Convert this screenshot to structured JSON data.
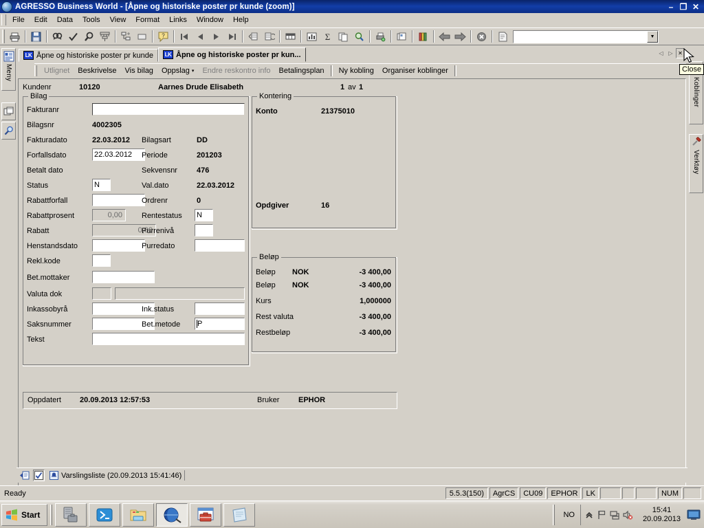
{
  "window": {
    "title": "AGRESSO Business World - [Åpne og historiske poster pr kunde (zoom)]",
    "app_icon": "globe-icon",
    "minimize": "–",
    "restore": "❐",
    "close": "✕"
  },
  "menubar": {
    "items": [
      {
        "label": "File"
      },
      {
        "label": "Edit"
      },
      {
        "label": "Data"
      },
      {
        "label": "Tools"
      },
      {
        "label": "View"
      },
      {
        "label": "Format"
      },
      {
        "label": "Links"
      },
      {
        "label": "Window"
      },
      {
        "label": "Help"
      }
    ]
  },
  "toolbar": {
    "buttons": [
      "print-icon",
      "save-icon",
      "find-icon",
      "check-icon",
      "zoom-icon",
      "filter-icon",
      "hierarchy-icon",
      "window-icon",
      "help-icon",
      "first-record-icon",
      "previous-record-icon",
      "next-record-icon",
      "last-record-icon",
      "insert-row-icon",
      "delete-row-icon",
      "table-icon",
      "chart-icon",
      "sum-icon",
      "copy-icon",
      "query-icon",
      "print-preview-icon",
      "cards-icon",
      "books-icon",
      "back-icon",
      "forward-icon",
      "cancel-icon",
      "document-icon"
    ],
    "combo_value": "",
    "combo_arrow": "▼"
  },
  "left_rail": {
    "tab_label": "Meny",
    "tab_icon": "menu-list-icon",
    "icons": [
      "copy-windows-icon",
      "search-magnifier-icon"
    ]
  },
  "right_rail": {
    "tabs": [
      {
        "label": "Koblinger",
        "icon": "links-chain-icon"
      },
      {
        "label": "Verktøy",
        "icon": "hammer-icon"
      }
    ]
  },
  "doc_tabs": {
    "tabs": [
      {
        "badge": "LK",
        "label": "Åpne og historiske poster pr kunde",
        "active": false
      },
      {
        "badge": "LK",
        "label": "Åpne og historiske poster pr kun...",
        "active": true
      }
    ],
    "nav": {
      "prev": "◁",
      "next": "▷",
      "close": "✕"
    }
  },
  "tooltip": {
    "text": "Close"
  },
  "function_band": {
    "left_items": [
      {
        "label": "Utlignet",
        "disabled": true
      },
      {
        "label": "Beskrivelse",
        "disabled": false
      },
      {
        "label": "Vis bilag",
        "disabled": false
      },
      {
        "label": "Oppslag",
        "disabled": false,
        "has_caret": true
      },
      {
        "label": "Endre reskontro info",
        "disabled": true
      },
      {
        "label": "Betalingsplan",
        "disabled": false
      }
    ],
    "right_items": [
      {
        "label": "Ny kobling",
        "disabled": false
      },
      {
        "label": "Organiser koblinger",
        "disabled": false
      }
    ],
    "caret": "▾"
  },
  "form": {
    "header": {
      "kundenr_label": "Kundenr",
      "kundenr_value": "10120",
      "customer_name": "Aarnes Drude Elisabeth",
      "record_position": "1",
      "record_of": "av",
      "record_total": "1"
    },
    "bilag": {
      "legend": "Bilag",
      "fakturanr_label": "Fakturanr",
      "fakturanr_value": "",
      "bilagsnr_label": "Bilagsnr",
      "bilagsnr_value": "4002305",
      "fakturadato_label": "Fakturadato",
      "fakturadato_value": "22.03.2012",
      "forfallsdato_label": "Forfallsdato",
      "forfallsdato_value": "22.03.2012",
      "betalt_dato_label": "Betalt dato",
      "betalt_dato_value": "",
      "status_label": "Status",
      "status_value": "N",
      "rabattforfall_label": "Rabattforfall",
      "rabattforfall_value": "",
      "rabattprosent_label": "Rabattprosent",
      "rabattprosent_value": "0,00",
      "rabatt_label": "Rabatt",
      "rabatt_value": "0,00",
      "henstandsdato_label": "Henstandsdato",
      "henstandsdato_value": "",
      "rekl_kode_label": "Rekl.kode",
      "rekl_kode_value": "",
      "bet_mottaker_label": "Bet.mottaker",
      "bet_mottaker_value": "",
      "valuta_dok_label": "Valuta dok",
      "valuta_dok_code": "",
      "valuta_dok_value": "",
      "inkassobyra_label": "Inkassobyrå",
      "inkassobyra_value": "",
      "saksnummer_label": "Saksnummer",
      "saksnummer_value": "",
      "tekst_label": "Tekst",
      "tekst_value": "",
      "bilagsart_label": "Bilagsart",
      "bilagsart_value": "DD",
      "periode_label": "Periode",
      "periode_value": "201203",
      "sekvensnr_label": "Sekvensnr",
      "sekvensnr_value": "476",
      "val_dato_label": "Val.dato",
      "val_dato_value": "22.03.2012",
      "ordrenr_label": "Ordrenr",
      "ordrenr_value": "0",
      "rentestatus_label": "Rentestatus",
      "rentestatus_value": "N",
      "purreniva_label": "Purrenivå",
      "purreniva_value": "",
      "purredato_label": "Purredato",
      "purredato_value": "",
      "ink_status_label": "Ink.status",
      "ink_status_value": "",
      "bet_metode_label": "Bet.metode",
      "bet_metode_value": "P"
    },
    "kontering": {
      "legend": "Kontering",
      "konto_label": "Konto",
      "konto_value": "21375010",
      "opdgiver_label": "Opdgiver",
      "opdgiver_value": "16"
    },
    "belop": {
      "legend": "Beløp",
      "rows": [
        {
          "label": "Beløp",
          "currency": "NOK",
          "value": "-3 400,00"
        },
        {
          "label": "Beløp",
          "currency": "NOK",
          "value": "-3 400,00"
        },
        {
          "label": "Kurs",
          "currency": "",
          "value": "1,000000"
        },
        {
          "label": "Rest valuta",
          "currency": "",
          "value": "-3 400,00"
        },
        {
          "label": "Restbeløp",
          "currency": "",
          "value": "-3 400,00"
        }
      ]
    },
    "footer": {
      "oppdatert_label": "Oppdatert",
      "oppdatert_value": "20.09.2013 12:57:53",
      "bruker_label": "Bruker",
      "bruker_value": "EPHOR"
    }
  },
  "notification_bar": {
    "buttons": [
      "new-window-icon",
      "checkbox-icon"
    ],
    "item": {
      "icon": "bell-icon",
      "label": "Varslingsliste (20.09.2013 15:41:46)"
    }
  },
  "statusbar": {
    "message": "Ready",
    "cells": [
      "5.5.3(150)",
      "AgrCS",
      "CU09",
      "EPHOR",
      "LK",
      "",
      "",
      "",
      "NUM",
      ""
    ]
  },
  "taskbar": {
    "start_label": "Start",
    "items": [
      {
        "icon": "server-toolbox-icon",
        "active": false
      },
      {
        "icon": "powershell-icon",
        "active": false
      },
      {
        "icon": "explorer-folder-icon",
        "active": false
      },
      {
        "icon": "internet-globe-icon",
        "active": true
      },
      {
        "icon": "toolbox-window-icon",
        "active": false
      },
      {
        "icon": "notepad-icon",
        "active": false
      }
    ],
    "tray": {
      "language": "NO",
      "icons": [
        "show-hidden-icons",
        "flag-icon",
        "network-icon",
        "volume-muted-icon"
      ],
      "time": "15:41",
      "date": "20.09.2013",
      "show_desktop": "show-desktop-icon"
    }
  }
}
